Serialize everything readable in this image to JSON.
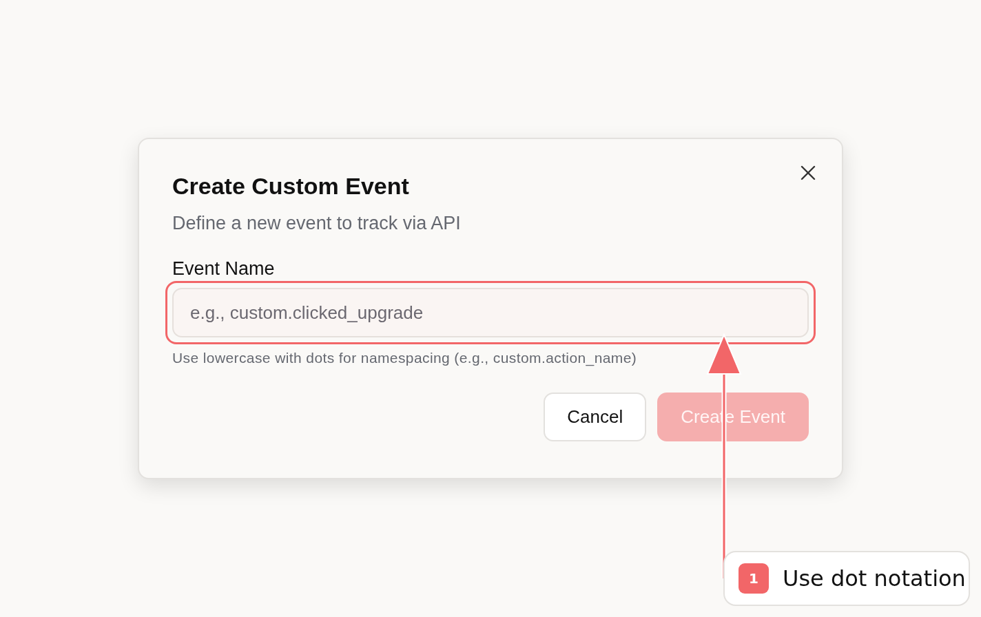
{
  "dialog": {
    "title": "Create Custom Event",
    "subtitle": "Define a new event to track via API",
    "field": {
      "label": "Event Name",
      "placeholder": "e.g., custom.clicked_upgrade",
      "help": "Use lowercase with dots for namespacing (e.g., custom.action_name)"
    },
    "buttons": [
      {
        "label": "Cancel",
        "kind": "secondary",
        "disabled": false
      },
      {
        "label": "Create Event",
        "kind": "primary",
        "disabled": true
      }
    ]
  },
  "annotations": [
    {
      "number": "1",
      "text": "Use dot notation"
    }
  ]
}
